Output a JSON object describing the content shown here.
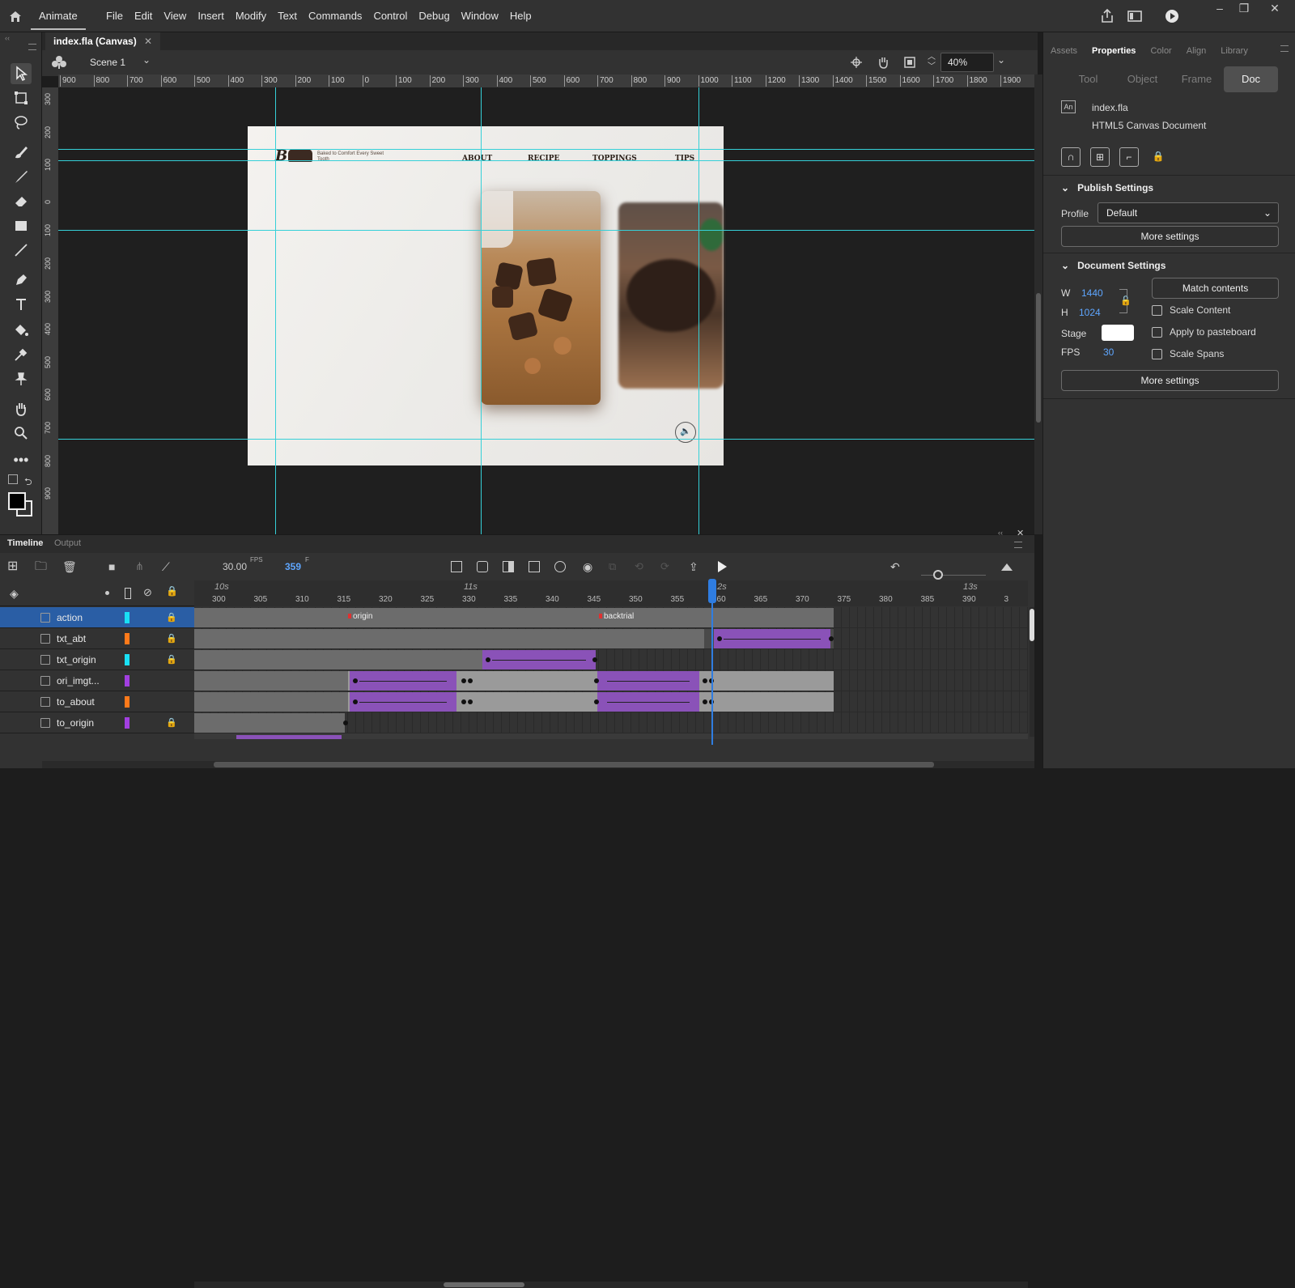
{
  "app": {
    "name": "Animate",
    "menus": [
      "File",
      "Edit",
      "View",
      "Insert",
      "Modify",
      "Text",
      "Commands",
      "Control",
      "Debug",
      "Window",
      "Help"
    ]
  },
  "document": {
    "tab_title": "index.fla (Canvas)",
    "scene": "Scene 1",
    "zoom": "40%"
  },
  "rulers": {
    "top": [
      "900",
      "800",
      "700",
      "600",
      "500",
      "400",
      "300",
      "200",
      "100",
      "0",
      "100",
      "200",
      "300",
      "400",
      "500",
      "600",
      "700",
      "800",
      "900",
      "1000",
      "1100",
      "1200",
      "1300",
      "1400",
      "1500",
      "1600",
      "1700",
      "1800",
      "1900"
    ],
    "left": [
      "300",
      "200",
      "100",
      "0",
      "100",
      "200",
      "300",
      "400",
      "500",
      "600",
      "700",
      "800",
      "900"
    ]
  },
  "stage_content": {
    "logo": "B",
    "tagline": "Baked to Comfort Every Sweet Tooth",
    "nav": [
      "ABOUT",
      "RECIPE",
      "TOPPINGS",
      "TIPS"
    ]
  },
  "properties": {
    "panel_tabs": [
      "Assets",
      "Properties",
      "Color",
      "Align",
      "Library"
    ],
    "active_tab": "Properties",
    "modes": [
      "Tool",
      "Object",
      "Frame",
      "Doc"
    ],
    "active_mode": "Doc",
    "file_name": "index.fla",
    "doc_type": "HTML5 Canvas Document",
    "publish": {
      "title": "Publish Settings",
      "profile_label": "Profile",
      "profile_value": "Default",
      "more_settings": "More settings"
    },
    "doc_settings": {
      "title": "Document Settings",
      "w_label": "W",
      "w_value": "1440",
      "h_label": "H",
      "h_value": "1024",
      "match_contents": "Match contents",
      "scale_content": "Scale Content",
      "stage_label": "Stage",
      "apply_pasteboard": "Apply to pasteboard",
      "fps_label": "FPS",
      "fps_value": "30",
      "scale_spans": "Scale Spans",
      "more_settings": "More settings"
    }
  },
  "timeline": {
    "tabs": [
      "Timeline",
      "Output"
    ],
    "fps": "30.00",
    "fps_unit": "FPS",
    "frame": "359",
    "frame_unit": "F",
    "seconds": [
      "10s",
      "11s",
      "12s",
      "13s"
    ],
    "frame_numbers": [
      "300",
      "305",
      "310",
      "315",
      "320",
      "325",
      "330",
      "335",
      "340",
      "345",
      "350",
      "355",
      "360",
      "365",
      "370",
      "375",
      "380",
      "385",
      "390",
      "3"
    ],
    "frame_labels": [
      "origin",
      "backtrial"
    ],
    "layers": [
      {
        "name": "action",
        "color": "#19e0f5",
        "locked": true,
        "selected": true
      },
      {
        "name": "txt_abt",
        "color": "#ff7a1a",
        "locked": true,
        "selected": false
      },
      {
        "name": "txt_origin",
        "color": "#19e0f5",
        "locked": true,
        "selected": false
      },
      {
        "name": "ori_imgt...",
        "color": "#a23fe0",
        "locked": false,
        "selected": false
      },
      {
        "name": "to_about",
        "color": "#ff7a1a",
        "locked": false,
        "selected": false
      },
      {
        "name": "to_origin",
        "color": "#a23fe0",
        "locked": true,
        "selected": false
      }
    ]
  }
}
